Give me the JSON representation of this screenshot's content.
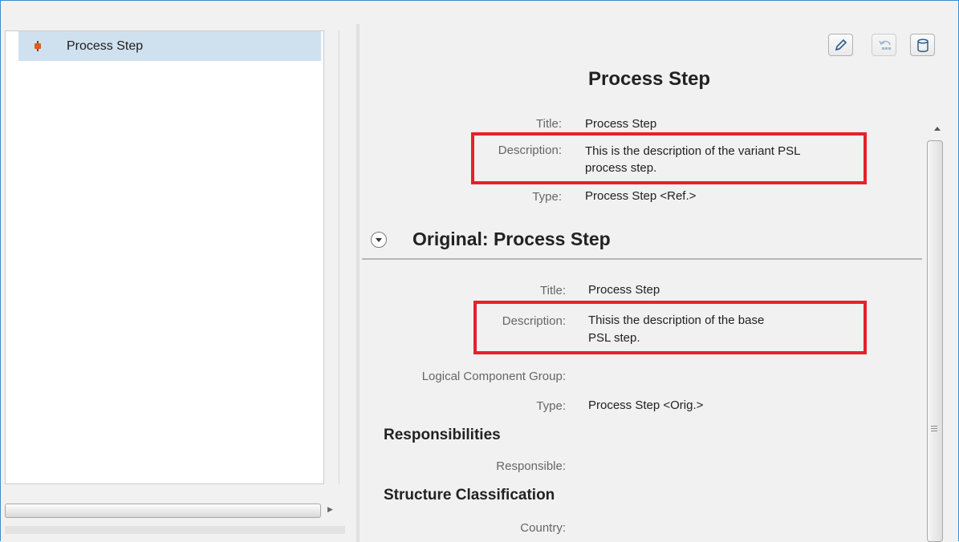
{
  "tree": {
    "items": [
      {
        "label": "Process Step",
        "icon": "process-step-icon",
        "selected": true
      }
    ]
  },
  "toolbar": {
    "edit_icon": "pencil-icon",
    "undo_icon": "undo-icon",
    "db_icon": "database-icon"
  },
  "detail": {
    "title": "Process Step",
    "variant": {
      "title_label": "Title:",
      "title_value": "Process Step",
      "description_label": "Description:",
      "description_line1": "This is the description of the variant PSL",
      "description_line2": "process step.",
      "type_label": "Type:",
      "type_value": "Process Step <Ref.>"
    },
    "original": {
      "section_title": "Original: Process Step",
      "title_label": "Title:",
      "title_value": "Process Step",
      "description_label": "Description:",
      "description_line1": "Thisis the description of the base",
      "description_line2": "PSL step.",
      "lcg_label": "Logical Component Group:",
      "type_label": "Type:",
      "type_value": "Process Step <Orig.>",
      "responsibilities_title": "Responsibilities",
      "responsible_label": "Responsible:",
      "structure_title": "Structure Classification",
      "country_label": "Country:"
    }
  },
  "colors": {
    "highlight": "#e8202a",
    "selection": "#cfe1ef",
    "frame": "#3a8fd0"
  }
}
